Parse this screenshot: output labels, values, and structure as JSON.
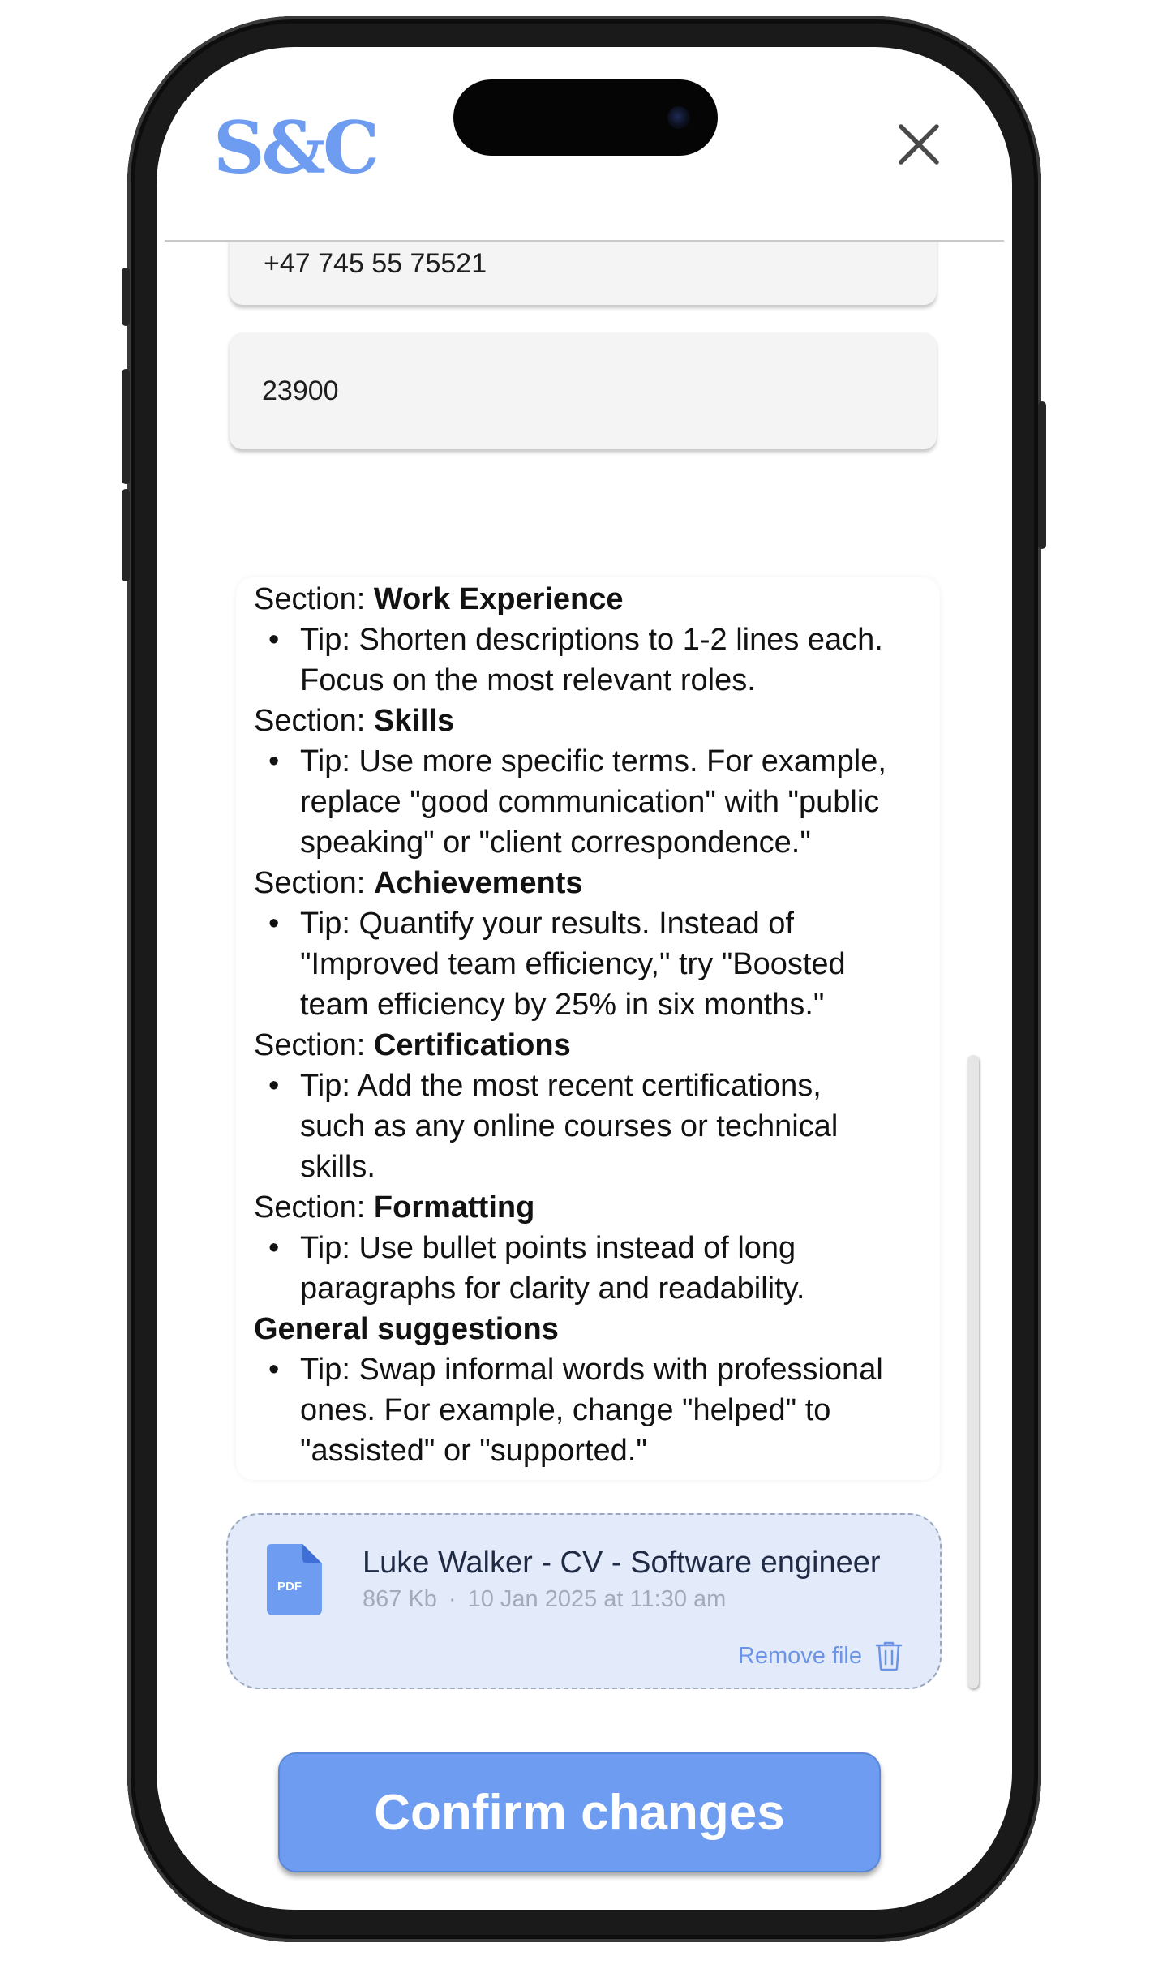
{
  "app": {
    "logo_text": "S&C"
  },
  "form": {
    "phone_value": "+47 745 55 75521",
    "zip_value": "23900"
  },
  "tips": {
    "sections": [
      {
        "prefix": "Section: ",
        "name": "Work Experience",
        "tip": "Tip: Shorten descriptions to 1-2 lines each.",
        "tip_cont": "Focus on the most relevant roles."
      },
      {
        "prefix": "Section: ",
        "name": "Skills",
        "tip": "Tip: Use more specific terms. For example,",
        "tip_cont": "replace \"good communication\" with \"public",
        "tip_cont2": "speaking\" or \"client correspondence.\""
      },
      {
        "prefix": "Section: ",
        "name": "Achievements",
        "tip": "Tip: Quantify your results. Instead of",
        "tip_cont": "\"Improved team efficiency,\" try \"Boosted",
        "tip_cont2": "team efficiency by 25% in six months.\""
      },
      {
        "prefix": "Section: ",
        "name": "Certifications",
        "tip": "Tip: Add the most recent certifications,",
        "tip_cont": "such as any online courses or technical",
        "tip_cont2": "skills."
      },
      {
        "prefix": "Section: ",
        "name": "Formatting",
        "tip": "Tip: Use bullet points instead of long",
        "tip_cont": "paragraphs for clarity and readability."
      }
    ],
    "general": {
      "title": "General suggestions",
      "tip": "Tip: Swap informal words with professional",
      "tip_cont": "ones. For example, change \"helped\" to",
      "tip_cont2": "\"assisted\" or \"supported.\""
    },
    "bullet": "•"
  },
  "file": {
    "icon_label": "PDF",
    "name": "Luke Walker - CV - Software engineer",
    "size": "867 Kb",
    "separator": "·",
    "date": "10 Jan 2025 at 11:30 am",
    "remove_label": "Remove file"
  },
  "actions": {
    "confirm_label": "Confirm changes"
  },
  "colors": {
    "accent": "#6d9cf0",
    "file_card_bg": "#e3ebfb",
    "field_bg": "#f4f4f4"
  },
  "icons": [
    "close-icon",
    "pdf-file-icon",
    "trash-icon"
  ]
}
